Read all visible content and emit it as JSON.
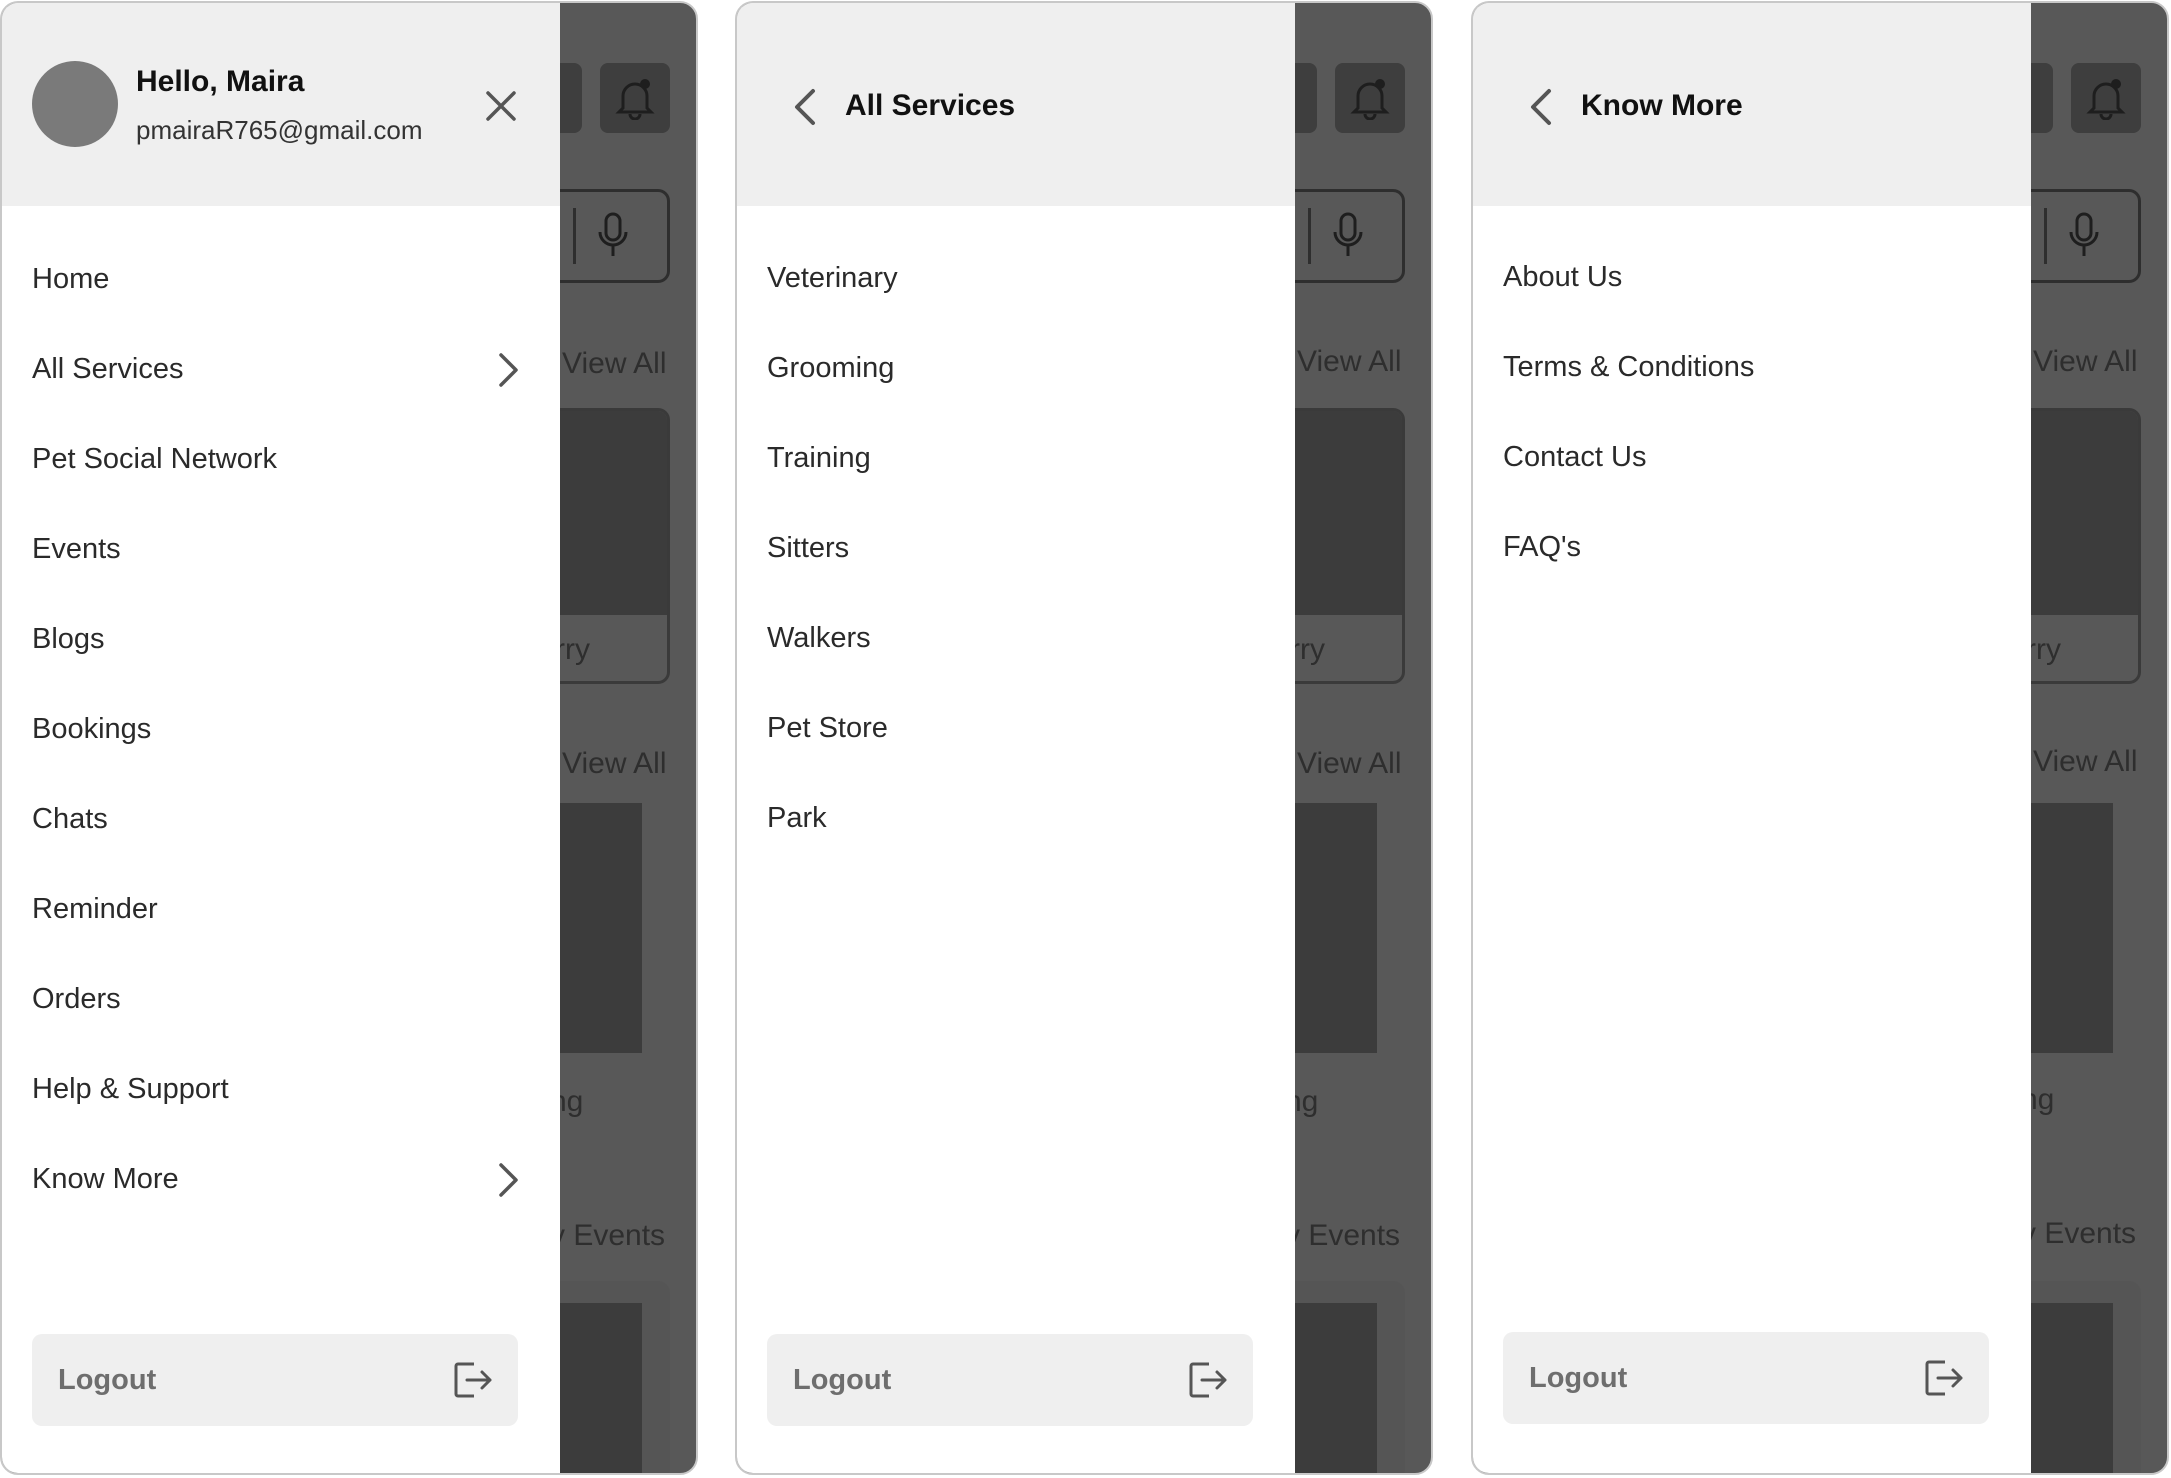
{
  "background": {
    "view_all_1": "View All",
    "card_text": "rry",
    "view_all_2": "View All",
    "section_text": "ng",
    "events_text": "v Events"
  },
  "panel1": {
    "greeting": "Hello, Maira",
    "email": "pmairaR765@gmail.com",
    "menu": [
      "Home",
      "All Services",
      "Pet Social Network",
      "Events",
      "Blogs",
      "Bookings",
      "Chats",
      "Reminder",
      "Orders",
      "Help & Support",
      "Know More"
    ],
    "logout": "Logout"
  },
  "panel2": {
    "title": "All Services",
    "menu": [
      "Veterinary",
      "Grooming",
      "Training",
      "Sitters",
      "Walkers",
      "Pet Store",
      "Park"
    ],
    "logout": "Logout"
  },
  "panel3": {
    "title": "Know More",
    "menu": [
      "About Us",
      "Terms & Conditions",
      "Contact Us",
      "FAQ's"
    ],
    "logout": "Logout"
  },
  "colors": {
    "overlay": "#585858",
    "header_bg": "#efefef",
    "logout_bg": "#efefef",
    "logout_text": "#6e6e6e"
  }
}
